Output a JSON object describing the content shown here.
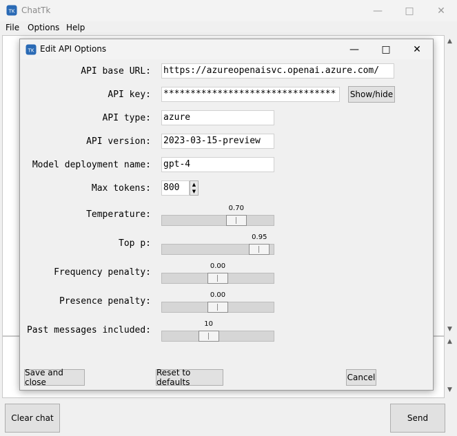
{
  "main_window": {
    "title": "ChatTk",
    "app_icon_text": "TK",
    "menu": [
      "File",
      "Options",
      "Help"
    ],
    "clear_chat_label": "Clear chat",
    "send_label": "Send"
  },
  "dialog": {
    "title": "Edit API Options",
    "fields": {
      "api_base_url": {
        "label": "API base URL:",
        "value": "https://azureopenaisvc.openai.azure.com/"
      },
      "api_key": {
        "label": "API key:",
        "value": "********************************"
      },
      "api_type": {
        "label": "API type:",
        "value": "azure"
      },
      "api_version": {
        "label": "API version:",
        "value": "2023-03-15-preview"
      },
      "model_deployment": {
        "label": "Model deployment name:",
        "value": "gpt-4"
      },
      "max_tokens": {
        "label": "Max tokens:",
        "value": "800"
      }
    },
    "show_hide_label": "Show/hide",
    "sliders": {
      "temperature": {
        "label": "Temperature:",
        "value": "0.70",
        "fraction": 0.7
      },
      "top_p": {
        "label": "Top p:",
        "value": "0.95",
        "fraction": 0.95
      },
      "frequency_penalty": {
        "label": "Frequency penalty:",
        "value": "0.00",
        "fraction": 0.5
      },
      "presence_penalty": {
        "label": "Presence penalty:",
        "value": "0.00",
        "fraction": 0.5
      },
      "past_messages": {
        "label": "Past messages included:",
        "value": "10",
        "fraction": 0.4
      }
    },
    "buttons": {
      "save_close": "Save and close",
      "reset": "Reset to defaults",
      "cancel": "Cancel"
    }
  }
}
